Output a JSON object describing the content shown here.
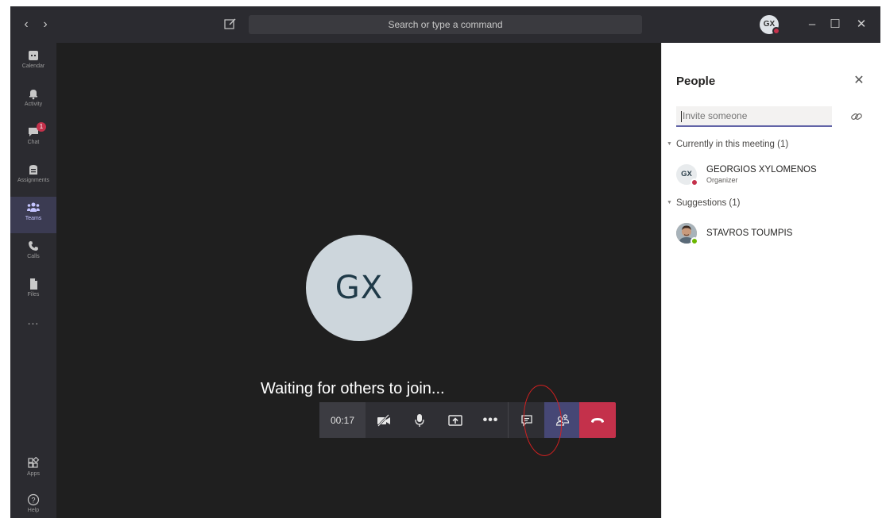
{
  "titlebar": {
    "search_text": "Search or type a command",
    "back_icon": "chevron-left-icon",
    "forward_icon": "chevron-right-icon",
    "compose_icon": "compose-icon",
    "user_initials": "GX",
    "minimize_icon": "minimize-icon",
    "maximize_icon": "maximize-icon",
    "close_icon": "close-icon"
  },
  "rail": {
    "items": [
      {
        "label": "Calendar",
        "icon": "calendar-icon"
      },
      {
        "label": "Activity",
        "icon": "bell-icon"
      },
      {
        "label": "Chat",
        "icon": "chat-icon",
        "badge": "1"
      },
      {
        "label": "Assignments",
        "icon": "assignments-icon"
      },
      {
        "label": "Teams",
        "icon": "teams-icon",
        "active": true
      },
      {
        "label": "Calls",
        "icon": "phone-icon"
      },
      {
        "label": "Files",
        "icon": "files-icon"
      },
      {
        "label": "...",
        "icon": "more-icon"
      }
    ],
    "bottom_items": [
      {
        "label": "Apps",
        "icon": "apps-icon"
      },
      {
        "label": "Help",
        "icon": "help-icon"
      }
    ]
  },
  "stage": {
    "avatar_initials": "GX",
    "waiting_text": "Waiting for others to join..."
  },
  "controls": {
    "timer": "00:17",
    "buttons": [
      "camera-off-icon",
      "microphone-icon",
      "share-screen-icon",
      "more-icon",
      "chat-icon",
      "people-icon",
      "hang-up-icon"
    ]
  },
  "people_panel": {
    "title": "People",
    "invite_placeholder": "Invite someone",
    "sections": [
      {
        "title": "Currently in this meeting (1)",
        "people": [
          {
            "initials": "GX",
            "name": "GEORGIOS XYLOMENOS",
            "role": "Organizer",
            "status_color": "#c4314b"
          }
        ]
      },
      {
        "title": "Suggestions (1)",
        "people": [
          {
            "initials": "",
            "name": "STAVROS TOUMPIS",
            "role": "",
            "status_color": "#6bb700"
          }
        ]
      }
    ]
  },
  "colors": {
    "accent": "#6264a7",
    "hangup": "#c4314b",
    "busy": "#c4314b",
    "available": "#6bb700"
  }
}
